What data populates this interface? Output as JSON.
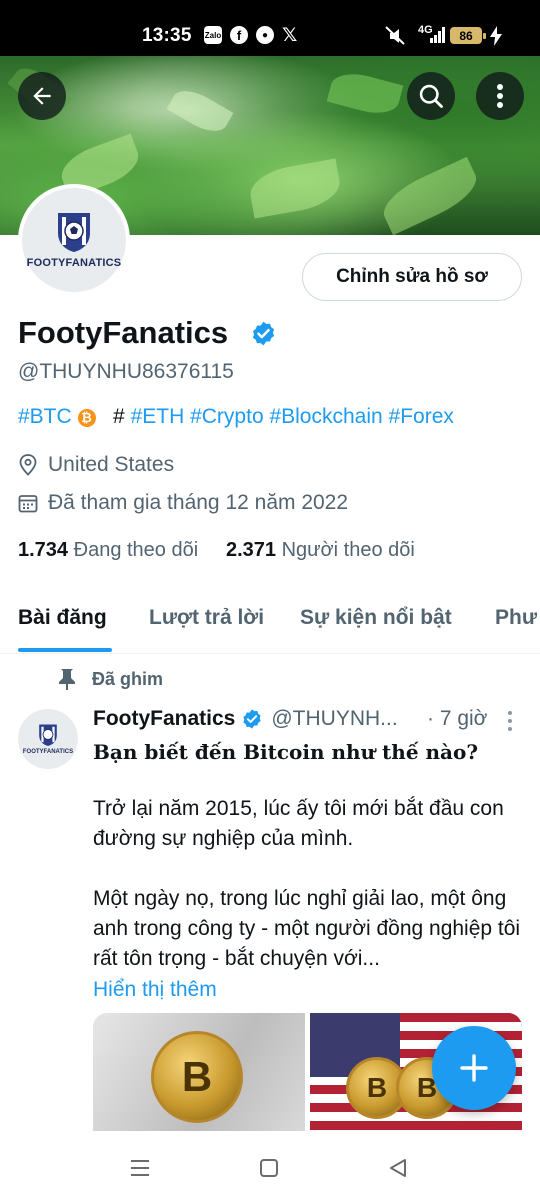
{
  "status_bar": {
    "time": "13:35",
    "notification_icons": [
      "zalo-icon",
      "facebook-icon",
      "reddit-icon",
      "x-icon"
    ],
    "network": "4G",
    "battery": "86"
  },
  "profile": {
    "avatar_text": "FOOTYFANATICS",
    "edit_button": "Chỉnh sửa hồ sơ",
    "display_name": "FootyFanatics",
    "verified": true,
    "handle": "@THUYNHU86376115",
    "bio": {
      "tag_btc": "#BTC",
      "btc_coin": "₿",
      "hash": "#",
      "tags": "#ETH #Crypto #Blockchain #Forex"
    },
    "location": "United States",
    "joined": "Đã tham gia tháng 12 năm 2022",
    "following_count": "1.734",
    "following_label": "Đang theo dõi",
    "followers_count": "2.371",
    "followers_label": "Người theo dõi"
  },
  "tabs": [
    "Bài đăng",
    "Lượt trả lời",
    "Sự kiện nổi bật",
    "Phương tiện"
  ],
  "tab_visible": [
    "Bài đăng",
    "Lượt trả lời",
    "Sự kiện nổi bật",
    "Phư"
  ],
  "pinned_post": {
    "pinned_label": "Đã ghim",
    "author_name": "FootyFanatics",
    "author_handle": "@THUYNH...",
    "time": "· 7 giờ",
    "title": "Bạn biết đến Bitcoin như thế nào?",
    "paragraph1": "Trở lại năm 2015, lúc ấy tôi mới bắt đầu con đường sự nghiệp của mình.",
    "paragraph2": "Một ngày nọ, trong lúc nghỉ giải lao, một ông anh trong công ty - một người đồng nghiệp tôi rất tôn trọng - bắt chuyện với...",
    "show_more": "Hiển thị thêm",
    "coin_symbol": "B"
  },
  "colors": {
    "accent": "#1d9bf0",
    "text_primary": "#0f1419",
    "text_secondary": "#536471"
  }
}
